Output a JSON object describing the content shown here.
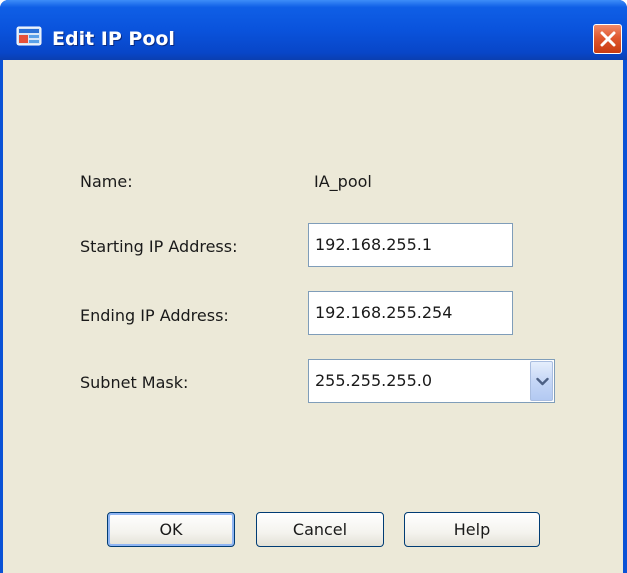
{
  "window": {
    "title": "Edit IP Pool",
    "icon": "asdm-app-icon",
    "close_icon": "close-x-icon"
  },
  "form": {
    "name_label": "Name:",
    "name_value": "IA_pool",
    "start_label": "Starting IP Address:",
    "start_value": "192.168.255.1",
    "end_label": "Ending IP Address:",
    "end_value": "192.168.255.254",
    "mask_label": "Subnet Mask:",
    "mask_value": "255.255.255.0",
    "mask_dropdown_icon": "chevron-down-icon"
  },
  "buttons": {
    "ok": "OK",
    "cancel": "Cancel",
    "help": "Help"
  },
  "colors": {
    "titlebar": "#0a53dc",
    "client_bg": "#ece9d8",
    "close_button": "#e0582f",
    "button_border": "#003c74"
  }
}
